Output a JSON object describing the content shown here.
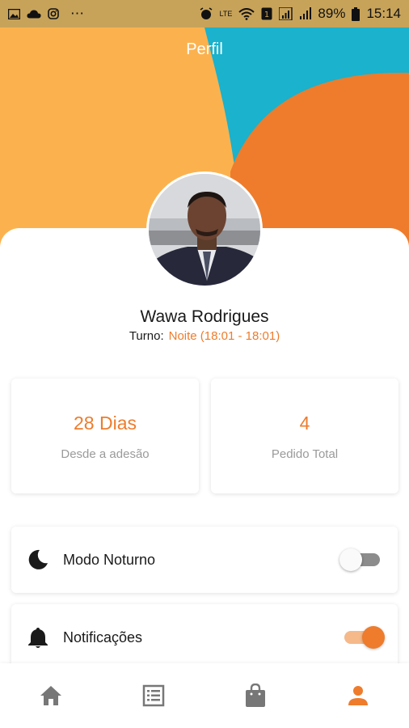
{
  "status_bar": {
    "battery": "89%",
    "time": "15:14",
    "network_label": "LTE",
    "left_icons": [
      "gallery-icon",
      "cloud-icon",
      "instagram-icon",
      "more-dots-icon"
    ],
    "right_icons": [
      "alarm-icon",
      "volte-icon",
      "wifi-icon",
      "sim-icon",
      "signal-icon",
      "battery-icon"
    ]
  },
  "header": {
    "title": "Perfil"
  },
  "profile": {
    "name": "Wawa Rodrigues",
    "shift_label": "Turno:",
    "shift_value": "Noite (18:01 - 18:01)"
  },
  "stats": [
    {
      "value": "28 Dias",
      "label": "Desde a adesão"
    },
    {
      "value": "4",
      "label": "Pedido Total"
    }
  ],
  "settings": {
    "dark_mode": {
      "label": "Modo Noturno",
      "icon": "moon-icon",
      "enabled": false
    },
    "notifications": {
      "label": "Notificações",
      "icon": "bell-icon",
      "enabled": true
    }
  },
  "bottom_nav": [
    {
      "name": "home",
      "icon": "home-icon",
      "active": false
    },
    {
      "name": "orders",
      "icon": "list-icon",
      "active": false
    },
    {
      "name": "shop",
      "icon": "bag-icon",
      "active": false
    },
    {
      "name": "profile",
      "icon": "person-icon",
      "active": true
    }
  ],
  "colors": {
    "accent": "#ee7c2c",
    "hero_yellow": "#fbb24e",
    "hero_teal": "#1ab2cc",
    "hero_orange": "#ee7c2c",
    "nav_inactive": "#777777"
  }
}
